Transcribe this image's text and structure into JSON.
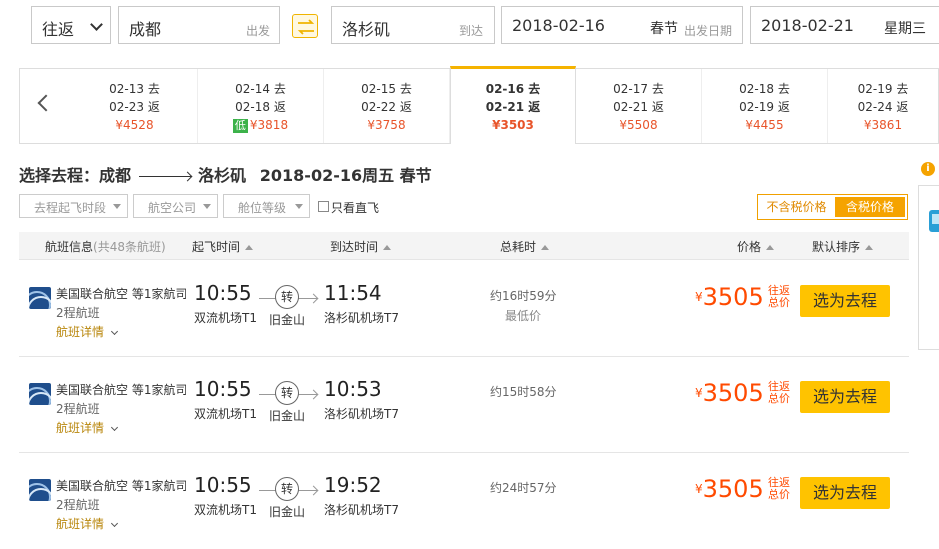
{
  "search": {
    "trip_type": "往返",
    "from_city": "成都",
    "from_hint": "出发",
    "to_city": "洛杉矶",
    "to_hint": "到达",
    "depart_date": "2018-02-16",
    "depart_festival": "春节",
    "depart_hint": "出发日期",
    "return_date": "2018-02-21",
    "return_weekday": "星期三"
  },
  "date_strip": [
    {
      "go": "02-13 去",
      "ret": "02-23 返",
      "price": "¥4528",
      "low": ""
    },
    {
      "go": "02-14 去",
      "ret": "02-18 返",
      "price": "¥3818",
      "low": "低"
    },
    {
      "go": "02-15 去",
      "ret": "02-22 返",
      "price": "¥3758",
      "low": ""
    },
    {
      "go": "02-16 去",
      "ret": "02-21 返",
      "price": "¥3503",
      "low": ""
    },
    {
      "go": "02-17 去",
      "ret": "02-21 返",
      "price": "¥5508",
      "low": ""
    },
    {
      "go": "02-18 去",
      "ret": "02-19 返",
      "price": "¥4455",
      "low": ""
    },
    {
      "go": "02-19 去",
      "ret": "02-24 返",
      "price": "¥3861",
      "low": ""
    }
  ],
  "heading": {
    "prefix": "选择去程：成都",
    "dest": "洛杉矶",
    "date": "2018-02-16周五 春节"
  },
  "filters": {
    "depart_slot": "去程起飞时段",
    "airline": "航空公司",
    "cabin": "舱位等级",
    "direct_only": "只看直飞",
    "tax_excluded": "不含税价格",
    "tax_included": "含税价格"
  },
  "table_header": {
    "flight_info": "航班信息",
    "count": "(共48条航班)",
    "depart_time": "起飞时间",
    "arrive_time": "到达时间",
    "duration": "总耗时",
    "price": "价格",
    "sort": "默认排序"
  },
  "flights": [
    {
      "airline": "美国联合航空 等1家航司",
      "stops": "2程航班",
      "detail": "航班详情",
      "dep_time": "10:55",
      "dep_airport": "双流机场T1",
      "transfer_label": "转",
      "transfer_city": "旧金山",
      "arr_time": "11:54",
      "arr_airport": "洛杉矶机场T7",
      "duration": "约16时59分",
      "tag": "最低价",
      "currency": "¥",
      "price": "3505",
      "price_note": "往返总价",
      "book": "选为去程"
    },
    {
      "airline": "美国联合航空 等1家航司",
      "stops": "2程航班",
      "detail": "航班详情",
      "dep_time": "10:55",
      "dep_airport": "双流机场T1",
      "transfer_label": "转",
      "transfer_city": "旧金山",
      "arr_time": "10:53",
      "arr_airport": "洛杉矶机场T7",
      "duration": "约15时58分",
      "tag": "",
      "currency": "¥",
      "price": "3505",
      "price_note": "往返总价",
      "book": "选为去程"
    },
    {
      "airline": "美国联合航空 等1家航司",
      "stops": "2程航班",
      "detail": "航班详情",
      "dep_time": "10:55",
      "dep_airport": "双流机场T1",
      "transfer_label": "转",
      "transfer_city": "旧金山",
      "arr_time": "19:52",
      "arr_airport": "洛杉矶机场T7",
      "duration": "约24时57分",
      "tag": "",
      "currency": "¥",
      "price": "3505",
      "price_note": "往返总价",
      "book": "选为去程"
    }
  ],
  "colors": {
    "accent": "#ffc300",
    "price": "#ff4a00",
    "tab_active": "#f5b300"
  }
}
